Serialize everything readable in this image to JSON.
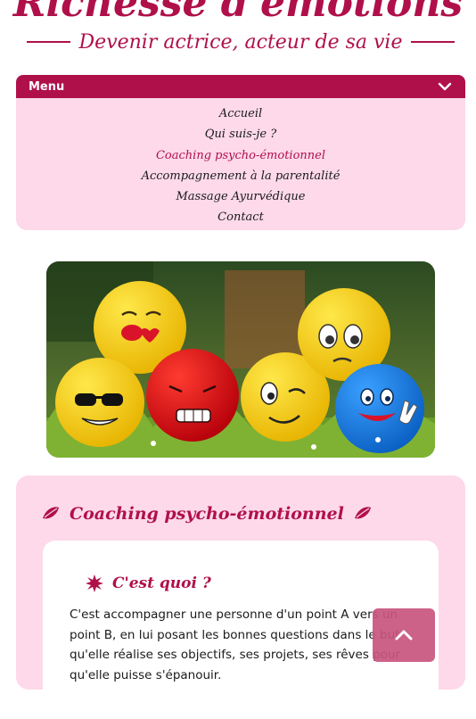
{
  "header": {
    "site_title": "Richesse d'émotions",
    "tagline": "Devenir actrice, acteur de sa vie"
  },
  "menu": {
    "label": "Menu",
    "toggle_icon": "chevron-down-icon",
    "items": [
      {
        "label": "Accueil",
        "active": false
      },
      {
        "label": "Qui suis-je ?",
        "active": false
      },
      {
        "label": "Coaching psycho-émotionnel",
        "active": true
      },
      {
        "label": "Accompagnement à la parentalité",
        "active": false
      },
      {
        "label": "Massage Ayurvédique",
        "active": false
      },
      {
        "label": "Contact",
        "active": false
      }
    ]
  },
  "hero": {
    "image_icon": "emoji-balls-photo"
  },
  "section": {
    "title": "Coaching psycho-émotionnel",
    "card": {
      "title": "C'est quoi ?",
      "text": "C'est accompagner une personne d'un point A vers un point B, en lui posant les bonnes questions dans le but qu'elle réalise ses objectifs, ses projets, ses rêves pour qu'elle puisse s'épanouir."
    }
  },
  "scroll_top": {
    "icon": "chevron-up-icon"
  },
  "colors": {
    "brand": "#b0104a",
    "panel": "#fdd9ea",
    "scroll_button": "#c9557f"
  }
}
